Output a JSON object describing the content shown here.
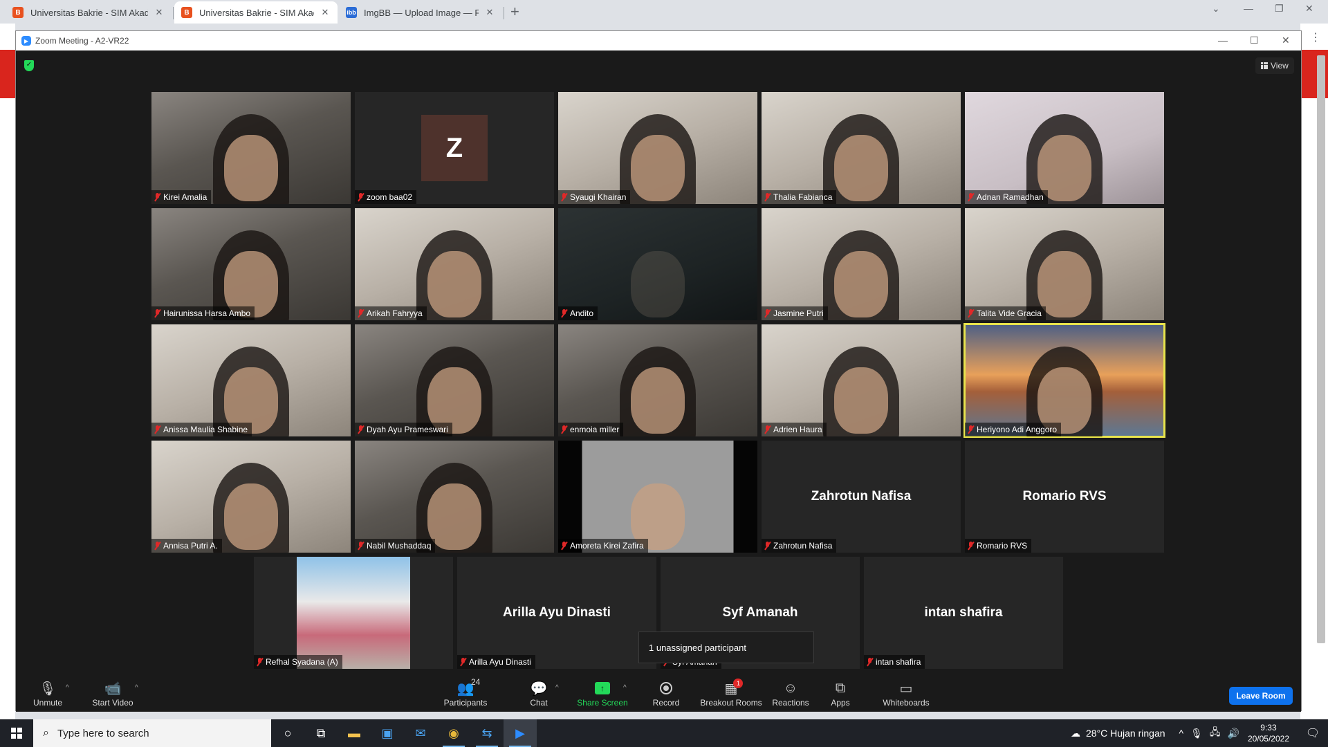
{
  "browser": {
    "tabs": [
      {
        "title": "Universitas Bakrie - SIM Akadem",
        "favicon": "UB",
        "active": false
      },
      {
        "title": "Universitas Bakrie - SIM Akadem",
        "favicon": "UB",
        "active": true
      },
      {
        "title": "ImgBB — Upload Image — Free",
        "favicon": "ibb",
        "active": false
      }
    ],
    "new_tab": "+"
  },
  "zoom": {
    "window_title": "Zoom Meeting - A2-VR22",
    "view_label": "View",
    "tiles": [
      {
        "name": "Kirei Amalia",
        "kind": "video",
        "style": "video"
      },
      {
        "name": "zoom baa02",
        "kind": "avatar",
        "initial": "Z"
      },
      {
        "name": "Syaugi Khairan",
        "kind": "video",
        "style": "bright"
      },
      {
        "name": "Thalia Fabianca",
        "kind": "video",
        "style": "bright"
      },
      {
        "name": "Adnan Ramadhan",
        "kind": "video",
        "style": "pink"
      },
      {
        "name": "Hairunissa Harsa Ambo",
        "kind": "video",
        "style": "video"
      },
      {
        "name": "Arikah Fahryya",
        "kind": "video",
        "style": "bright"
      },
      {
        "name": "Andito",
        "kind": "video",
        "style": "dark"
      },
      {
        "name": "Jasmine Putri",
        "kind": "video",
        "style": "bright"
      },
      {
        "name": "Talita Vide Gracia",
        "kind": "video",
        "style": "bright"
      },
      {
        "name": "Anissa Maulia Shabine",
        "kind": "video",
        "style": "bright"
      },
      {
        "name": "Dyah Ayu Prameswari",
        "kind": "video",
        "style": "video"
      },
      {
        "name": "enmoia miller",
        "kind": "video",
        "style": "video"
      },
      {
        "name": "Adrien Haura",
        "kind": "video",
        "style": "bright"
      },
      {
        "name": "Heriyono Adi Anggoro",
        "kind": "video",
        "style": "sky",
        "talking": true
      },
      {
        "name": "Annisa Putri A.",
        "kind": "video",
        "style": "bright"
      },
      {
        "name": "Nabil Mushaddaq",
        "kind": "video",
        "style": "video"
      },
      {
        "name": "Amoreta Kirei Zafira",
        "kind": "video",
        "style": "bw"
      },
      {
        "name": "Zahrotun Nafisa",
        "kind": "name"
      },
      {
        "name": "Romario RVS",
        "kind": "name"
      },
      {
        "name": "Refhal Syadana (A)",
        "kind": "inner"
      },
      {
        "name": "Arilla Ayu Dinasti",
        "kind": "name"
      },
      {
        "name": "Syf Amanah",
        "kind": "name"
      },
      {
        "name": "intan shafira",
        "kind": "name"
      }
    ],
    "tooltip": "1 unassigned participant",
    "toolbar": {
      "unmute": "Unmute",
      "start_video": "Start Video",
      "participants": "Participants",
      "participants_count": "24",
      "chat": "Chat",
      "share_screen": "Share Screen",
      "record": "Record",
      "breakout_rooms": "Breakout Rooms",
      "breakout_badge": "1",
      "reactions": "Reactions",
      "apps": "Apps",
      "whiteboards": "Whiteboards",
      "leave_room": "Leave Room"
    }
  },
  "taskbar": {
    "search_placeholder": "Type here to search",
    "weather": "28°C  Hujan ringan",
    "time": "9:33",
    "date": "20/05/2022"
  },
  "colors": {
    "zoom_blue": "#0e72ed",
    "share_green": "#23d959",
    "mute_red": "#e02828",
    "active_speaker": "#e8e44c"
  }
}
